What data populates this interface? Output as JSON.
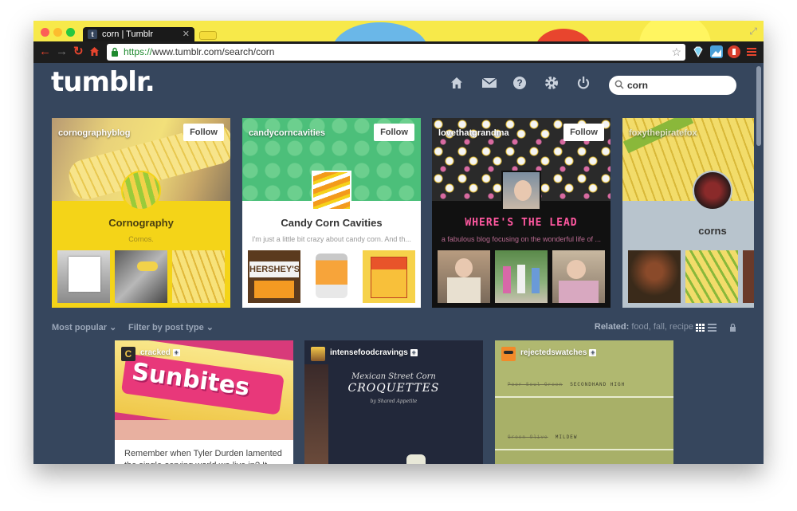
{
  "browser": {
    "tab_title": "corn | Tumblr",
    "tab_favicon": "t",
    "url_scheme": "https://",
    "url_rest": "www.tumblr.com/search/corn"
  },
  "header": {
    "logo": "tumblr.",
    "search_value": "corn"
  },
  "blogs": [
    {
      "name": "cornographyblog",
      "title": "Cornography",
      "description": "Cornos.",
      "follow": "Follow"
    },
    {
      "name": "candycorncavities",
      "title": "Candy Corn Cavities",
      "description": "I'm just a little bit crazy about candy corn. And th...",
      "follow": "Follow"
    },
    {
      "name": "lovethatgrandma",
      "title": "WHERE'S THE LEAD",
      "description": "a fabulous blog focusing on the wonderful life of ...",
      "follow": "Follow"
    },
    {
      "name": "foxythepiratefox",
      "title": "corns",
      "description": "",
      "follow": ""
    }
  ],
  "filters": {
    "sort": "Most popular",
    "post_type": "Filter by post type",
    "related_label": "Related:",
    "related_tags": "food, fall, recipe"
  },
  "posts": [
    {
      "blog": "cracked",
      "caption": "Remember when Tyler Durden lamented the single-serving world we live in? It",
      "image_text": "Sunbites",
      "avatar_letter": "C"
    },
    {
      "blog": "intensefoodcravings",
      "image_line1": "Mexican Street Corn",
      "image_line2": "CROQUETTES",
      "image_line3": "by Shared Appetite"
    },
    {
      "blog": "rejectedswatches",
      "swatch_1": "SECONDHAND HIGH",
      "swatch_2": "MILDEW"
    }
  ],
  "colors": {
    "dashboard_bg": "#36465d",
    "tab_strip": "#f7e94a",
    "cornography_bg": "#f4d418",
    "candy_bg": "#ffffff",
    "grandma_bg": "#111111",
    "fox_bg": "#b8c4cd"
  }
}
